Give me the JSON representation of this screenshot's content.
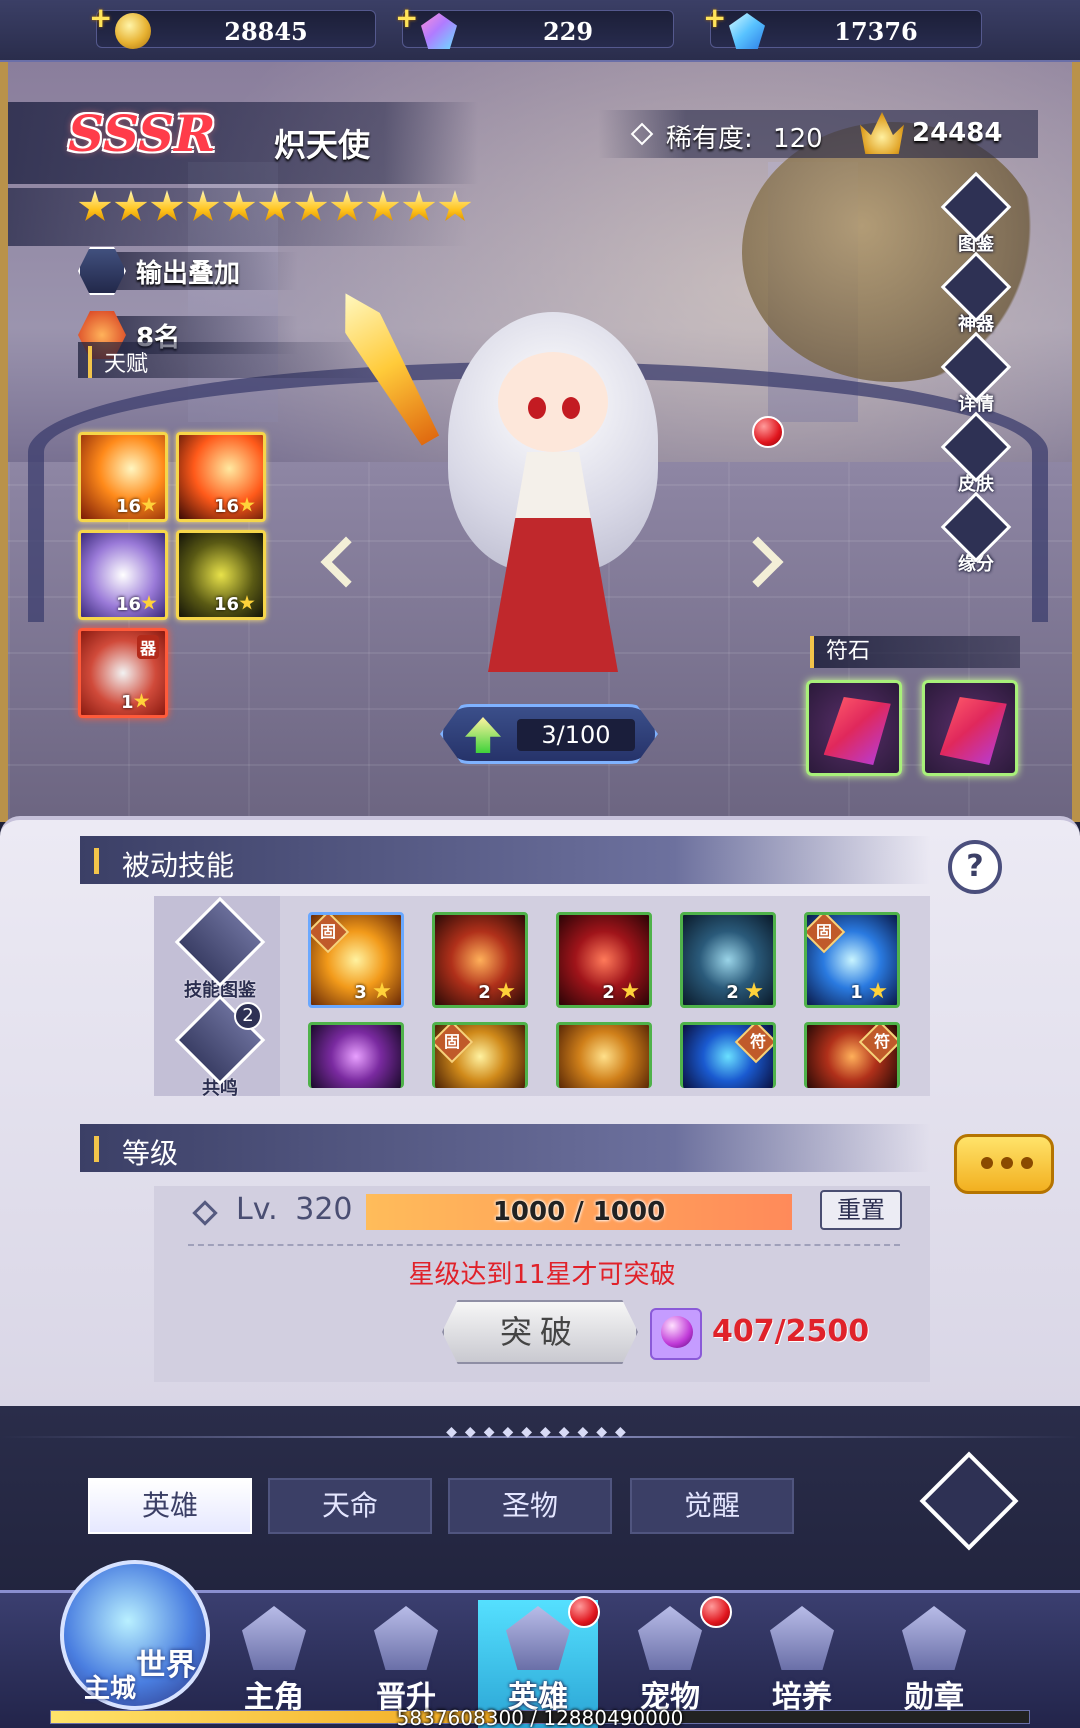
{
  "currency": [
    {
      "icon": "gold-coin-icon",
      "value": "28845"
    },
    {
      "icon": "rainbow-gem-icon",
      "value": "229"
    },
    {
      "icon": "blue-diamond-icon",
      "value": "17376"
    }
  ],
  "hero": {
    "rarity_tier": "SSSR",
    "name": "炽天使",
    "rarity_label": "稀有度:",
    "rarity_value": "120",
    "power": "24484",
    "stars": 11,
    "tags": [
      {
        "icon": "crossed-swords-icon",
        "label": "输出叠加"
      },
      {
        "icon": "flame-icon",
        "label": "8名"
      }
    ],
    "talent_title": "天赋",
    "talents": [
      {
        "icon": "claw-slash-icon",
        "level": "16"
      },
      {
        "icon": "fire-blade-icon",
        "level": "16"
      },
      {
        "icon": "wind-slash-icon",
        "level": "16"
      },
      {
        "icon": "shadow-aura-icon",
        "level": "16"
      },
      {
        "icon": "sword-artifact-icon",
        "level": "1",
        "tag": "器"
      }
    ],
    "exp": "3/100"
  },
  "side_menu": [
    "图鉴",
    "神器",
    "详情",
    "皮肤",
    "缘分"
  ],
  "rune": {
    "title": "符石",
    "slots": [
      "red-rune-icon",
      "red-rune-icon"
    ]
  },
  "passive": {
    "title": "被动技能",
    "help": "?",
    "left_buttons": [
      {
        "icon": "skill-codex-icon",
        "label": "技能图鉴"
      },
      {
        "icon": "resonance-icon",
        "label": "共鸣",
        "badge": "2"
      }
    ],
    "skills_row1": [
      {
        "icon": "golden-blast-icon",
        "level": "3",
        "tag": "固",
        "border": "blue"
      },
      {
        "icon": "demon-warrior-icon",
        "level": "2",
        "border": "green"
      },
      {
        "icon": "red-claw-icon",
        "level": "2",
        "border": "green"
      },
      {
        "icon": "shatter-icon",
        "level": "2",
        "border": "green"
      },
      {
        "icon": "vortex-icon",
        "level": "1",
        "tag": "固",
        "border": "green"
      }
    ],
    "skills_row2": [
      {
        "icon": "purple-strike-icon",
        "border": "green"
      },
      {
        "icon": "golden-cross-icon",
        "tag": "固",
        "border": "green"
      },
      {
        "icon": "golden-shield-icon",
        "border": "green"
      },
      {
        "icon": "blue-spirit-icon",
        "tag_right": "符",
        "border": "green"
      },
      {
        "icon": "demon-warrior-icon",
        "tag_right": "符",
        "border": "green"
      }
    ]
  },
  "level": {
    "title": "等级",
    "lv_label": "Lv.",
    "lv_value": "320",
    "exp_text": "1000 / 1000",
    "exp_fraction": 1.0,
    "reset": "重置",
    "warning": "星级达到11星才可突破",
    "break_label": "突破",
    "material_count": "407/2500"
  },
  "sub_tabs": [
    {
      "label": "英雄",
      "active": true
    },
    {
      "label": "天命",
      "active": false
    },
    {
      "label": "圣物",
      "active": false
    },
    {
      "label": "觉醒",
      "active": false
    }
  ],
  "nav": {
    "world": {
      "label1": "世界",
      "label2": "主城"
    },
    "items": [
      {
        "label": "主角",
        "active": false,
        "dot": false
      },
      {
        "label": "晋升",
        "active": false,
        "dot": false
      },
      {
        "label": "英雄",
        "active": true,
        "dot": true
      },
      {
        "label": "宠物",
        "active": false,
        "dot": true
      },
      {
        "label": "培养",
        "active": false,
        "dot": false
      },
      {
        "label": "勋章",
        "active": false,
        "dot": false
      }
    ]
  },
  "xp": {
    "text": "5837608300 / 12880490000",
    "fraction": 0.453
  },
  "colors": {
    "accent_gold": "#f2c44a",
    "warning_red": "#e0222a",
    "panel_dark": "#3b3f66",
    "active_tab": "#55e0ff"
  }
}
